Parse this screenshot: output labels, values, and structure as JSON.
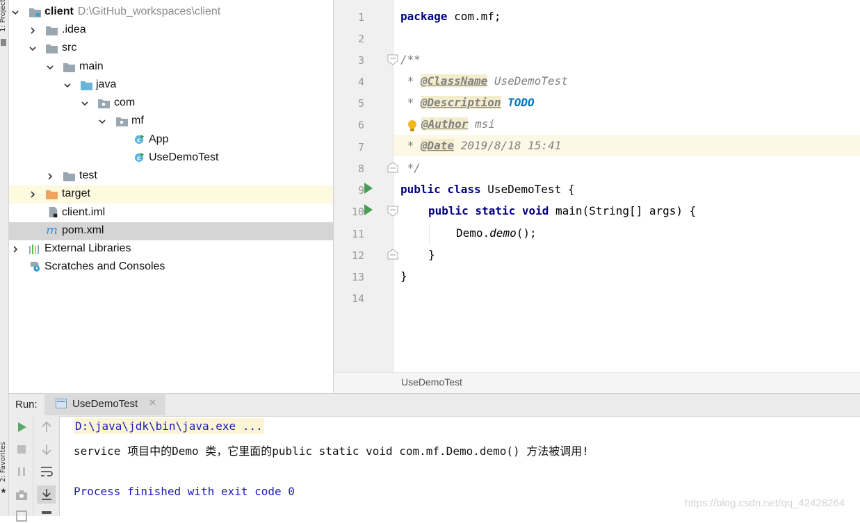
{
  "tool_strip": {
    "project_label": "1: Project",
    "favorites_label": "2: Favorites"
  },
  "project_tree": [
    {
      "label": "client",
      "sub": "D:\\GitHub_workspaces\\client",
      "icon": "module-folder-icon"
    },
    {
      "label": ".idea",
      "icon": "folder-icon"
    },
    {
      "label": "src",
      "icon": "folder-icon"
    },
    {
      "label": "main",
      "icon": "folder-icon"
    },
    {
      "label": "java",
      "icon": "source-folder-icon"
    },
    {
      "label": "com",
      "icon": "package-icon"
    },
    {
      "label": "mf",
      "icon": "package-icon"
    },
    {
      "label": "App",
      "icon": "java-class-icon"
    },
    {
      "label": "UseDemoTest",
      "icon": "java-class-icon"
    },
    {
      "label": "test",
      "icon": "folder-icon"
    },
    {
      "label": "target",
      "icon": "excluded-folder-icon"
    },
    {
      "label": "client.iml",
      "icon": "iml-file-icon"
    },
    {
      "label": "pom.xml",
      "icon": "maven-icon"
    },
    {
      "label": "External Libraries",
      "icon": "libraries-icon"
    },
    {
      "label": "Scratches and Consoles",
      "icon": "scratches-icon"
    }
  ],
  "editor": {
    "line_numbers": [
      "1",
      "2",
      "3",
      "4",
      "5",
      "6",
      "7",
      "8",
      "9",
      "10",
      "11",
      "12",
      "13",
      "14"
    ],
    "code": {
      "l1_kw": "package",
      "l1_rest": " com.mf;",
      "l3": "/**",
      "l4_star": " * ",
      "l4_tag": "@ClassName",
      "l4_val": " UseDemoTest",
      "l5_star": " * ",
      "l5_tag": "@Description",
      "l5_sp": " ",
      "l5_todo": "TODO",
      "l6_tag": "@Author",
      "l6_val": " msi",
      "l7_star": " * ",
      "l7_tag": "@Date",
      "l7_val": " 2019/8/18 15:41",
      "l8": " */",
      "l9_kw": "public class",
      "l9_rest": " UseDemoTest {",
      "l10_kw": "public static void",
      "l10_rest": " main(String[] args) {",
      "l11_a": "Demo.",
      "l11_b": "demo",
      "l11_c": "();",
      "l12": "}",
      "l13": "}"
    },
    "breadcrumb": "UseDemoTest"
  },
  "run": {
    "label": "Run:",
    "tab": "UseDemoTest",
    "console": [
      "D:\\java\\jdk\\bin\\java.exe ...",
      "service 项目中的Demo 类，它里面的public static void com.mf.Demo.demo() 方法被调用!",
      "",
      "Process finished with exit code 0"
    ]
  },
  "watermark": "https://blog.csdn.net/qq_42428264",
  "colors": {
    "keyword": "#000080",
    "doc_comment": "#808080",
    "todo": "#0073bf",
    "run_green": "#499c54",
    "console_blue": "#1b1bb4"
  }
}
